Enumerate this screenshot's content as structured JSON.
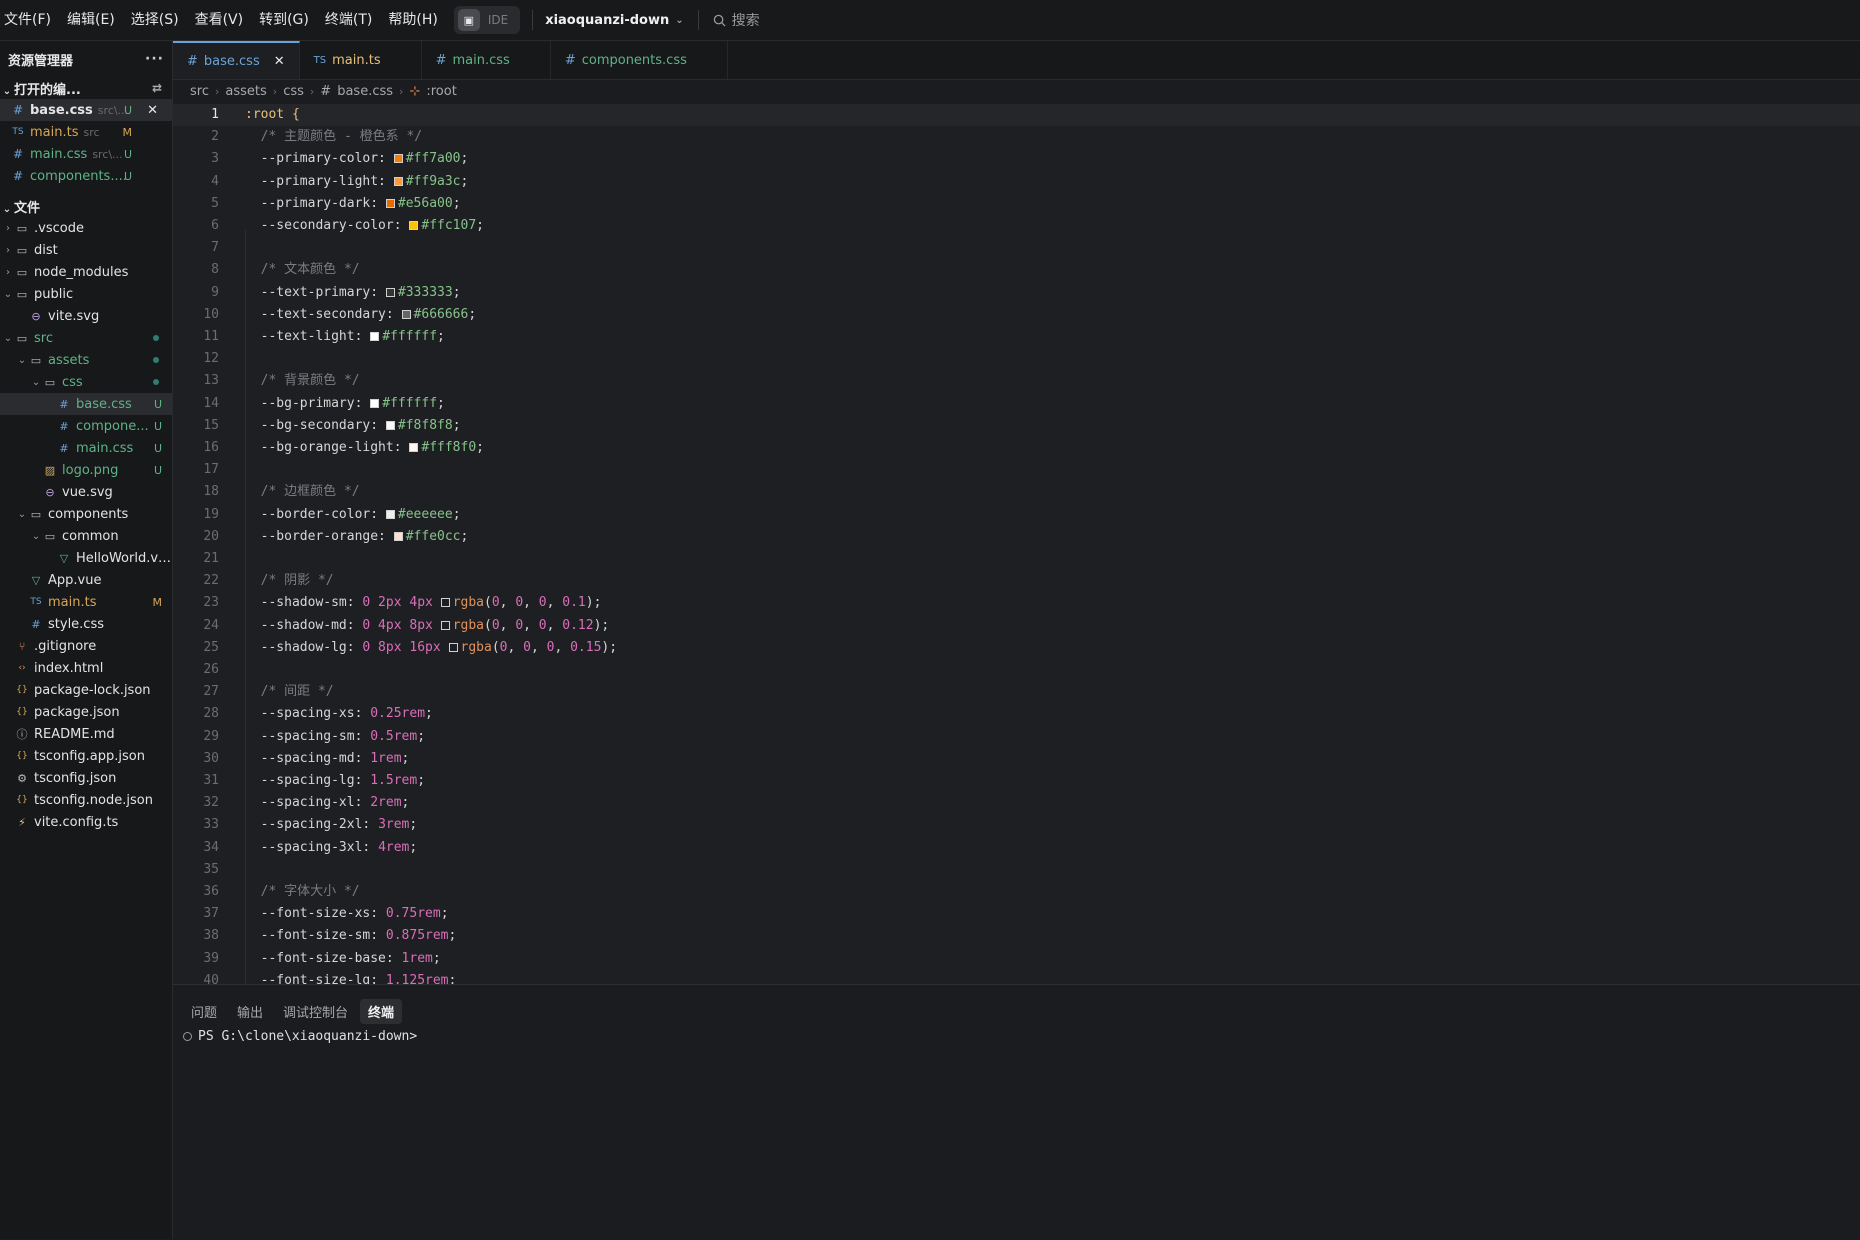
{
  "menu": [
    "文件(F)",
    "编辑(E)",
    "选择(S)",
    "查看(V)",
    "转到(G)",
    "终端(T)",
    "帮助(H)"
  ],
  "ide_label": "IDE",
  "project_name": "xiaoquanzi-down",
  "search_label": "搜索",
  "sidebar": {
    "title": "资源管理器",
    "open_editors_label": "打开的编...",
    "open_editors": [
      {
        "icon": "#",
        "name": "base.css",
        "sub": "src\\...",
        "badge": "U",
        "color": "green",
        "active": true
      },
      {
        "icon": "TS",
        "name": "main.ts",
        "sub": "src",
        "badge": "M",
        "color": "yellow",
        "active": false
      },
      {
        "icon": "#",
        "name": "main.css",
        "sub": "src\\...",
        "badge": "U",
        "color": "green",
        "active": false
      },
      {
        "icon": "#",
        "name": "components....",
        "sub": "",
        "badge": "U",
        "color": "green",
        "active": false
      }
    ],
    "files_label": "文件",
    "tree": [
      {
        "d": 0,
        "tw": "›",
        "icon": "folder",
        "name": ".vscode",
        "color": "white"
      },
      {
        "d": 0,
        "tw": "›",
        "icon": "folder",
        "name": "dist",
        "color": "white"
      },
      {
        "d": 0,
        "tw": "›",
        "icon": "folder",
        "name": "node_modules",
        "color": "white"
      },
      {
        "d": 0,
        "tw": "⌄",
        "icon": "folder-open",
        "name": "public",
        "color": "white"
      },
      {
        "d": 1,
        "tw": "",
        "icon": "svg",
        "name": "vite.svg",
        "color": "white"
      },
      {
        "d": 0,
        "tw": "⌄",
        "icon": "folder-open",
        "name": "src",
        "color": "green",
        "dot": true
      },
      {
        "d": 1,
        "tw": "⌄",
        "icon": "folder-open",
        "name": "assets",
        "color": "green",
        "dot": true
      },
      {
        "d": 2,
        "tw": "⌄",
        "icon": "folder-open",
        "name": "css",
        "color": "green",
        "dot": true
      },
      {
        "d": 3,
        "tw": "",
        "icon": "hash",
        "name": "base.css",
        "color": "green",
        "badge": "U",
        "sel": true
      },
      {
        "d": 3,
        "tw": "",
        "icon": "hash",
        "name": "compone...",
        "color": "green",
        "badge": "U"
      },
      {
        "d": 3,
        "tw": "",
        "icon": "hash",
        "name": "main.css",
        "color": "green",
        "badge": "U"
      },
      {
        "d": 2,
        "tw": "",
        "icon": "image",
        "name": "logo.png",
        "color": "green",
        "badge": "U"
      },
      {
        "d": 2,
        "tw": "",
        "icon": "svg",
        "name": "vue.svg",
        "color": "white"
      },
      {
        "d": 1,
        "tw": "⌄",
        "icon": "folder-open",
        "name": "components",
        "color": "white"
      },
      {
        "d": 2,
        "tw": "⌄",
        "icon": "folder-open",
        "name": "common",
        "color": "white"
      },
      {
        "d": 3,
        "tw": "",
        "icon": "vue",
        "name": "HelloWorld.vue",
        "color": "white"
      },
      {
        "d": 1,
        "tw": "",
        "icon": "vue",
        "name": "App.vue",
        "color": "white"
      },
      {
        "d": 1,
        "tw": "",
        "icon": "ts",
        "name": "main.ts",
        "color": "yellow",
        "badge": "M"
      },
      {
        "d": 1,
        "tw": "",
        "icon": "hash",
        "name": "style.css",
        "color": "white"
      },
      {
        "d": 0,
        "tw": "",
        "icon": "git",
        "name": ".gitignore",
        "color": "white"
      },
      {
        "d": 0,
        "tw": "",
        "icon": "html",
        "name": "index.html",
        "color": "white"
      },
      {
        "d": 0,
        "tw": "",
        "icon": "json",
        "name": "package-lock.json",
        "color": "white"
      },
      {
        "d": 0,
        "tw": "",
        "icon": "json",
        "name": "package.json",
        "color": "white"
      },
      {
        "d": 0,
        "tw": "",
        "icon": "info",
        "name": "README.md",
        "color": "white"
      },
      {
        "d": 0,
        "tw": "",
        "icon": "json",
        "name": "tsconfig.app.json",
        "color": "white"
      },
      {
        "d": 0,
        "tw": "",
        "icon": "gear",
        "name": "tsconfig.json",
        "color": "white"
      },
      {
        "d": 0,
        "tw": "",
        "icon": "json",
        "name": "tsconfig.node.json",
        "color": "white"
      },
      {
        "d": 0,
        "tw": "",
        "icon": "bolt",
        "name": "vite.config.ts",
        "color": "white"
      }
    ]
  },
  "tabs": [
    {
      "icon": "#",
      "label": "base.css",
      "active": true,
      "color": "blue"
    },
    {
      "icon": "TS",
      "label": "main.ts",
      "active": false,
      "color": "yellow"
    },
    {
      "icon": "#",
      "label": "main.css",
      "active": false,
      "color": "green"
    },
    {
      "icon": "#",
      "label": "components.css",
      "active": false,
      "color": "green"
    }
  ],
  "breadcrumb": [
    "src",
    "assets",
    "css",
    "base.css",
    ":root"
  ],
  "code_lines": [
    [
      {
        "t": "sel",
        "v": ":root "
      },
      {
        "t": "brace",
        "v": "{"
      }
    ],
    [
      {
        "t": "cm",
        "v": "  /* 主题颜色 - 橙色系 */"
      }
    ],
    [
      {
        "t": "prop",
        "v": "  --primary-color: "
      },
      {
        "t": "sw",
        "v": "#ff7a00"
      },
      {
        "t": "hex",
        "v": "#ff7a00"
      },
      {
        "t": "punc",
        "v": ";"
      }
    ],
    [
      {
        "t": "prop",
        "v": "  --primary-light: "
      },
      {
        "t": "sw",
        "v": "#ff9a3c"
      },
      {
        "t": "hex",
        "v": "#ff9a3c"
      },
      {
        "t": "punc",
        "v": ";"
      }
    ],
    [
      {
        "t": "prop",
        "v": "  --primary-dark: "
      },
      {
        "t": "sw",
        "v": "#e56a00"
      },
      {
        "t": "hex",
        "v": "#e56a00"
      },
      {
        "t": "punc",
        "v": ";"
      }
    ],
    [
      {
        "t": "prop",
        "v": "  --secondary-color: "
      },
      {
        "t": "sw",
        "v": "#ffc107"
      },
      {
        "t": "hex",
        "v": "#ffc107"
      },
      {
        "t": "punc",
        "v": ";"
      }
    ],
    [],
    [
      {
        "t": "cm",
        "v": "  /* 文本颜色 */"
      }
    ],
    [
      {
        "t": "prop",
        "v": "  --text-primary: "
      },
      {
        "t": "sw",
        "v": "#333333"
      },
      {
        "t": "hex",
        "v": "#333333"
      },
      {
        "t": "punc",
        "v": ";"
      }
    ],
    [
      {
        "t": "prop",
        "v": "  --text-secondary: "
      },
      {
        "t": "sw",
        "v": "#666666"
      },
      {
        "t": "hex",
        "v": "#666666"
      },
      {
        "t": "punc",
        "v": ";"
      }
    ],
    [
      {
        "t": "prop",
        "v": "  --text-light: "
      },
      {
        "t": "sw",
        "v": "#ffffff"
      },
      {
        "t": "hex",
        "v": "#ffffff"
      },
      {
        "t": "punc",
        "v": ";"
      }
    ],
    [],
    [
      {
        "t": "cm",
        "v": "  /* 背景颜色 */"
      }
    ],
    [
      {
        "t": "prop",
        "v": "  --bg-primary: "
      },
      {
        "t": "sw",
        "v": "#ffffff"
      },
      {
        "t": "hex",
        "v": "#ffffff"
      },
      {
        "t": "punc",
        "v": ";"
      }
    ],
    [
      {
        "t": "prop",
        "v": "  --bg-secondary: "
      },
      {
        "t": "sw",
        "v": "#f8f8f8"
      },
      {
        "t": "hex",
        "v": "#f8f8f8"
      },
      {
        "t": "punc",
        "v": ";"
      }
    ],
    [
      {
        "t": "prop",
        "v": "  --bg-orange-light: "
      },
      {
        "t": "sw",
        "v": "#fff8f0"
      },
      {
        "t": "hex",
        "v": "#fff8f0"
      },
      {
        "t": "punc",
        "v": ";"
      }
    ],
    [],
    [
      {
        "t": "cm",
        "v": "  /* 边框颜色 */"
      }
    ],
    [
      {
        "t": "prop",
        "v": "  --border-color: "
      },
      {
        "t": "sw",
        "v": "#eeeeee"
      },
      {
        "t": "hex",
        "v": "#eeeeee"
      },
      {
        "t": "punc",
        "v": ";"
      }
    ],
    [
      {
        "t": "prop",
        "v": "  --border-orange: "
      },
      {
        "t": "sw",
        "v": "#ffe0cc"
      },
      {
        "t": "hex",
        "v": "#ffe0cc"
      },
      {
        "t": "punc",
        "v": ";"
      }
    ],
    [],
    [
      {
        "t": "cm",
        "v": "  /* 阴影 */"
      }
    ],
    [
      {
        "t": "prop",
        "v": "  --shadow-sm: "
      },
      {
        "t": "num",
        "v": "0 2px 4px "
      },
      {
        "t": "sw",
        "v": "#000000"
      },
      {
        "t": "fn",
        "v": "rgba"
      },
      {
        "t": "punc",
        "v": "("
      },
      {
        "t": "num",
        "v": "0"
      },
      {
        "t": "punc",
        "v": ", "
      },
      {
        "t": "num",
        "v": "0"
      },
      {
        "t": "punc",
        "v": ", "
      },
      {
        "t": "num",
        "v": "0"
      },
      {
        "t": "punc",
        "v": ", "
      },
      {
        "t": "num",
        "v": "0.1"
      },
      {
        "t": "punc",
        "v": ");"
      }
    ],
    [
      {
        "t": "prop",
        "v": "  --shadow-md: "
      },
      {
        "t": "num",
        "v": "0 4px 8px "
      },
      {
        "t": "sw",
        "v": "#000000"
      },
      {
        "t": "fn",
        "v": "rgba"
      },
      {
        "t": "punc",
        "v": "("
      },
      {
        "t": "num",
        "v": "0"
      },
      {
        "t": "punc",
        "v": ", "
      },
      {
        "t": "num",
        "v": "0"
      },
      {
        "t": "punc",
        "v": ", "
      },
      {
        "t": "num",
        "v": "0"
      },
      {
        "t": "punc",
        "v": ", "
      },
      {
        "t": "num",
        "v": "0.12"
      },
      {
        "t": "punc",
        "v": ");"
      }
    ],
    [
      {
        "t": "prop",
        "v": "  --shadow-lg: "
      },
      {
        "t": "num",
        "v": "0 8px 16px "
      },
      {
        "t": "sw",
        "v": "#000000"
      },
      {
        "t": "fn",
        "v": "rgba"
      },
      {
        "t": "punc",
        "v": "("
      },
      {
        "t": "num",
        "v": "0"
      },
      {
        "t": "punc",
        "v": ", "
      },
      {
        "t": "num",
        "v": "0"
      },
      {
        "t": "punc",
        "v": ", "
      },
      {
        "t": "num",
        "v": "0"
      },
      {
        "t": "punc",
        "v": ", "
      },
      {
        "t": "num",
        "v": "0.15"
      },
      {
        "t": "punc",
        "v": ");"
      }
    ],
    [],
    [
      {
        "t": "cm",
        "v": "  /* 间距 */"
      }
    ],
    [
      {
        "t": "prop",
        "v": "  --spacing-xs: "
      },
      {
        "t": "num",
        "v": "0.25rem"
      },
      {
        "t": "punc",
        "v": ";"
      }
    ],
    [
      {
        "t": "prop",
        "v": "  --spacing-sm: "
      },
      {
        "t": "num",
        "v": "0.5rem"
      },
      {
        "t": "punc",
        "v": ";"
      }
    ],
    [
      {
        "t": "prop",
        "v": "  --spacing-md: "
      },
      {
        "t": "num",
        "v": "1rem"
      },
      {
        "t": "punc",
        "v": ";"
      }
    ],
    [
      {
        "t": "prop",
        "v": "  --spacing-lg: "
      },
      {
        "t": "num",
        "v": "1.5rem"
      },
      {
        "t": "punc",
        "v": ";"
      }
    ],
    [
      {
        "t": "prop",
        "v": "  --spacing-xl: "
      },
      {
        "t": "num",
        "v": "2rem"
      },
      {
        "t": "punc",
        "v": ";"
      }
    ],
    [
      {
        "t": "prop",
        "v": "  --spacing-2xl: "
      },
      {
        "t": "num",
        "v": "3rem"
      },
      {
        "t": "punc",
        "v": ";"
      }
    ],
    [
      {
        "t": "prop",
        "v": "  --spacing-3xl: "
      },
      {
        "t": "num",
        "v": "4rem"
      },
      {
        "t": "punc",
        "v": ";"
      }
    ],
    [],
    [
      {
        "t": "cm",
        "v": "  /* 字体大小 */"
      }
    ],
    [
      {
        "t": "prop",
        "v": "  --font-size-xs: "
      },
      {
        "t": "num",
        "v": "0.75rem"
      },
      {
        "t": "punc",
        "v": ";"
      }
    ],
    [
      {
        "t": "prop",
        "v": "  --font-size-sm: "
      },
      {
        "t": "num",
        "v": "0.875rem"
      },
      {
        "t": "punc",
        "v": ";"
      }
    ],
    [
      {
        "t": "prop",
        "v": "  --font-size-base: "
      },
      {
        "t": "num",
        "v": "1rem"
      },
      {
        "t": "punc",
        "v": ";"
      }
    ],
    [
      {
        "t": "prop",
        "v": "  --font-size-lg: "
      },
      {
        "t": "num",
        "v": "1.125rem"
      },
      {
        "t": "punc",
        "v": ";"
      }
    ]
  ],
  "current_line": 1,
  "panel": {
    "tabs": [
      "问题",
      "输出",
      "调试控制台",
      "终端"
    ],
    "active_tab": "终端",
    "terminal_prompt": "PS G:\\clone\\xiaoquanzi-down>"
  }
}
